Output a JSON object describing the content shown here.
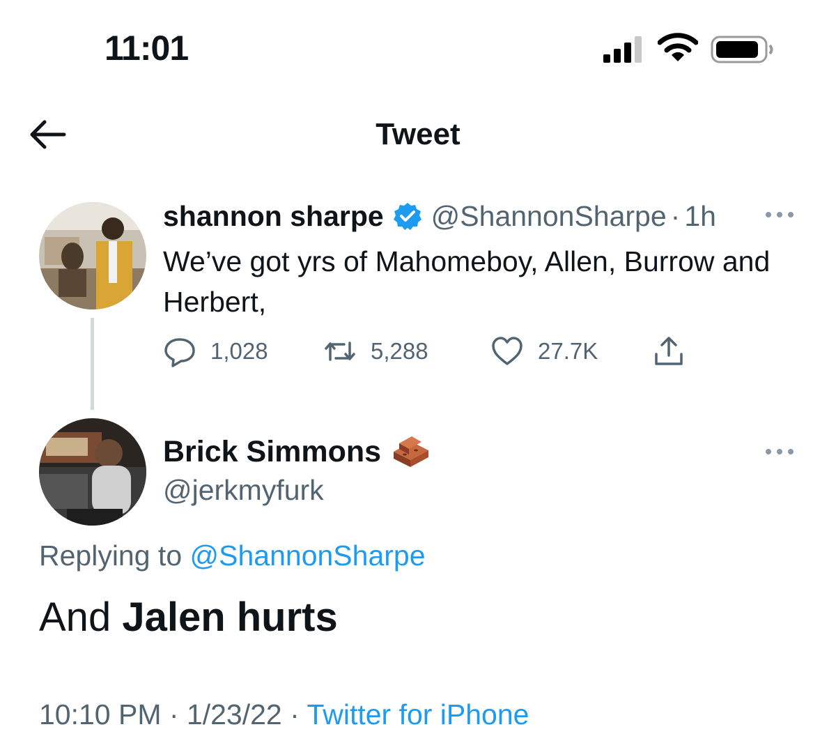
{
  "status_bar": {
    "time": "11:01"
  },
  "header": {
    "title": "Tweet"
  },
  "tweet": {
    "name": "shannon sharpe",
    "handle": "@ShannonSharpe",
    "separator": "·",
    "age": "1h",
    "text": "We’ve got yrs of Mahomeboy, Allen, Burrow and Herbert,",
    "replies": "1,028",
    "retweets": "5,288",
    "likes": "27.7K"
  },
  "reply": {
    "name": "Brick Simmons",
    "handle": "@jerkmyfurk",
    "replying_prefix": "Replying to ",
    "replying_handle": "@ShannonSharpe",
    "text_plain": "And ",
    "text_bold": "Jalen hurts",
    "time": "10:10 PM",
    "sep1": " · ",
    "date": "1/23/22",
    "sep2": " · ",
    "source": "Twitter for iPhone"
  },
  "colors": {
    "link": "#1d9bf0",
    "secondary_text": "#536471",
    "primary_text": "#0f1419"
  },
  "icons": [
    "back-arrow-icon",
    "verified-badge-icon",
    "more-icon",
    "reply-icon",
    "retweet-icon",
    "like-icon",
    "share-icon",
    "brick-emoji-icon",
    "signal-icon",
    "wifi-icon",
    "battery-icon"
  ]
}
